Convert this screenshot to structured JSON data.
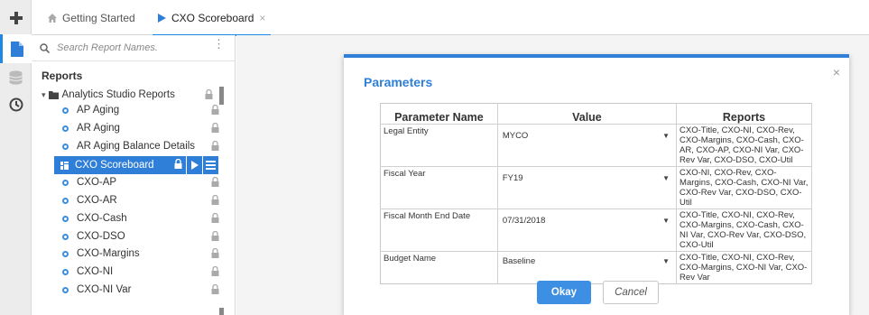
{
  "tabs": [
    {
      "label": "Getting Started",
      "icon": "home-icon",
      "active": false
    },
    {
      "label": "CXO Scoreboard",
      "icon": "play-icon",
      "active": true,
      "close": "×"
    }
  ],
  "rail": {
    "items": [
      "add-icon",
      "report-icon",
      "database-icon",
      "history-icon"
    ],
    "accent": "#1e88e5"
  },
  "sidebar": {
    "search_placeholder": "Search Report Names.",
    "menu_glyph": "⋮",
    "heading": "Reports",
    "folder": "Analytics Studio Reports",
    "items": [
      {
        "label": "AP Aging"
      },
      {
        "label": "AR Aging"
      },
      {
        "label": "AR Aging Balance Details"
      },
      {
        "label": "CXO Scoreboard",
        "selected": true
      },
      {
        "label": "CXO-AP"
      },
      {
        "label": "CXO-AR"
      },
      {
        "label": "CXO-Cash"
      },
      {
        "label": "CXO-DSO"
      },
      {
        "label": "CXO-Margins"
      },
      {
        "label": "CXO-NI"
      },
      {
        "label": "CXO-NI Var"
      }
    ],
    "selected_color": "#2f7fd8"
  },
  "modal": {
    "title": "Parameters",
    "close": "×",
    "columns": [
      "Parameter Name",
      "Value",
      "Reports"
    ],
    "rows": [
      {
        "name": "Legal Entity",
        "value": "MYCO",
        "reports": "CXO-Title, CXO-NI, CXO-Rev, CXO-Margins, CXO-Cash, CXO-AR, CXO-AP, CXO-NI Var, CXO-Rev Var, CXO-DSO, CXO-Util"
      },
      {
        "name": "Fiscal Year",
        "value": "FY19",
        "reports": "CXO-NI, CXO-Rev, CXO-Margins, CXO-Cash, CXO-NI Var, CXO-Rev Var, CXO-DSO, CXO-Util"
      },
      {
        "name": "Fiscal Month End Date",
        "value": "07/31/2018",
        "reports": "CXO-Title, CXO-NI, CXO-Rev, CXO-Margins, CXO-Cash, CXO-NI Var, CXO-Rev Var, CXO-DSO, CXO-Util"
      },
      {
        "name": "Budget Name",
        "value": "Baseline",
        "reports": "CXO-Title, CXO-NI, CXO-Rev, CXO-Margins, CXO-NI Var, CXO-Rev Var"
      }
    ],
    "okay_label": "Okay",
    "cancel_label": "Cancel",
    "accent": "#2f7fd8"
  }
}
